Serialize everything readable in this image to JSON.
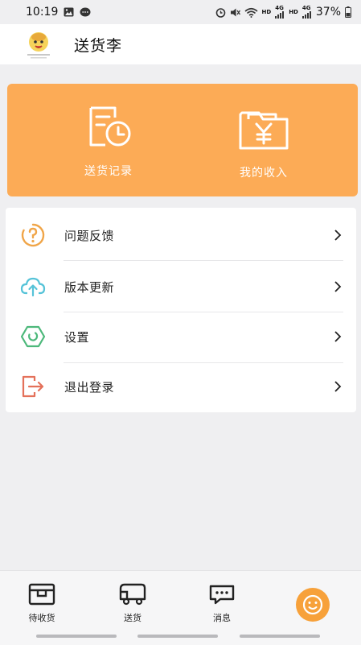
{
  "status_bar": {
    "time": "10:19",
    "hd1": "HD",
    "hd2": "HD",
    "net1": "4G",
    "net2": "4G",
    "battery": "37%",
    "icons": [
      "image-icon",
      "chat-bubble-icon",
      "alarm-icon",
      "mute-icon",
      "wifi-icon",
      "signal-icon",
      "battery-icon"
    ]
  },
  "header": {
    "title": "送货李",
    "avatar_icon": "mascot-avatar-icon"
  },
  "cards": [
    {
      "label": "送货记录",
      "icon": "delivery-record-icon"
    },
    {
      "label": "我的收入",
      "icon": "income-folder-icon"
    }
  ],
  "menu": [
    {
      "label": "问题反馈",
      "icon": "question-icon",
      "color": "#f0a548"
    },
    {
      "label": "版本更新",
      "icon": "cloud-upload-icon",
      "color": "#56c3d8"
    },
    {
      "label": "设置",
      "icon": "settings-hex-icon",
      "color": "#4cb87a"
    },
    {
      "label": "退出登录",
      "icon": "logout-icon",
      "color": "#e4715a"
    }
  ],
  "bottom_nav": [
    {
      "label": "待收货",
      "icon": "pending-receive-icon"
    },
    {
      "label": "送货",
      "icon": "truck-icon"
    },
    {
      "label": "消息",
      "icon": "message-icon"
    },
    {
      "label": "",
      "icon": "smile-profile-icon"
    }
  ],
  "colors": {
    "accent_orange": "#fcab56",
    "background": "#efeff1"
  }
}
